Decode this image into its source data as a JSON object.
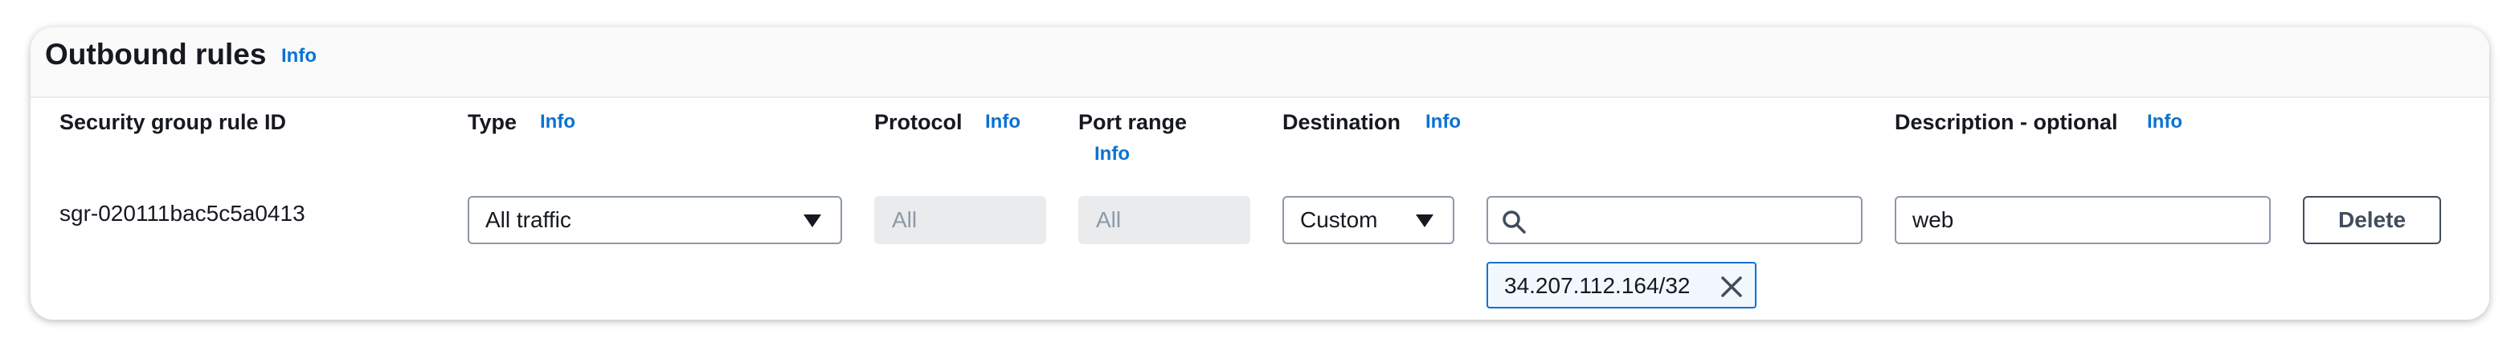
{
  "section": {
    "title": "Outbound rules",
    "info_label": "Info"
  },
  "columns": {
    "rule_id": "Security group rule ID",
    "type": "Type",
    "protocol": "Protocol",
    "port_range": "Port range",
    "destination": "Destination",
    "description": "Description - optional",
    "info_label": "Info"
  },
  "rule": {
    "id": "sgr-020111bac5c5a0413",
    "type": "All traffic",
    "protocol": "All",
    "port_range": "All",
    "destination_type": "Custom",
    "destination_search": "",
    "destination_token": "34.207.112.164/32",
    "description": "web",
    "delete_label": "Delete"
  },
  "colors": {
    "accent": "#0972d3",
    "text": "#16191f",
    "disabled_bg": "#e9ebed"
  },
  "icons": {
    "caret": "caret-down-icon",
    "search": "search-icon",
    "remove": "close-icon"
  }
}
